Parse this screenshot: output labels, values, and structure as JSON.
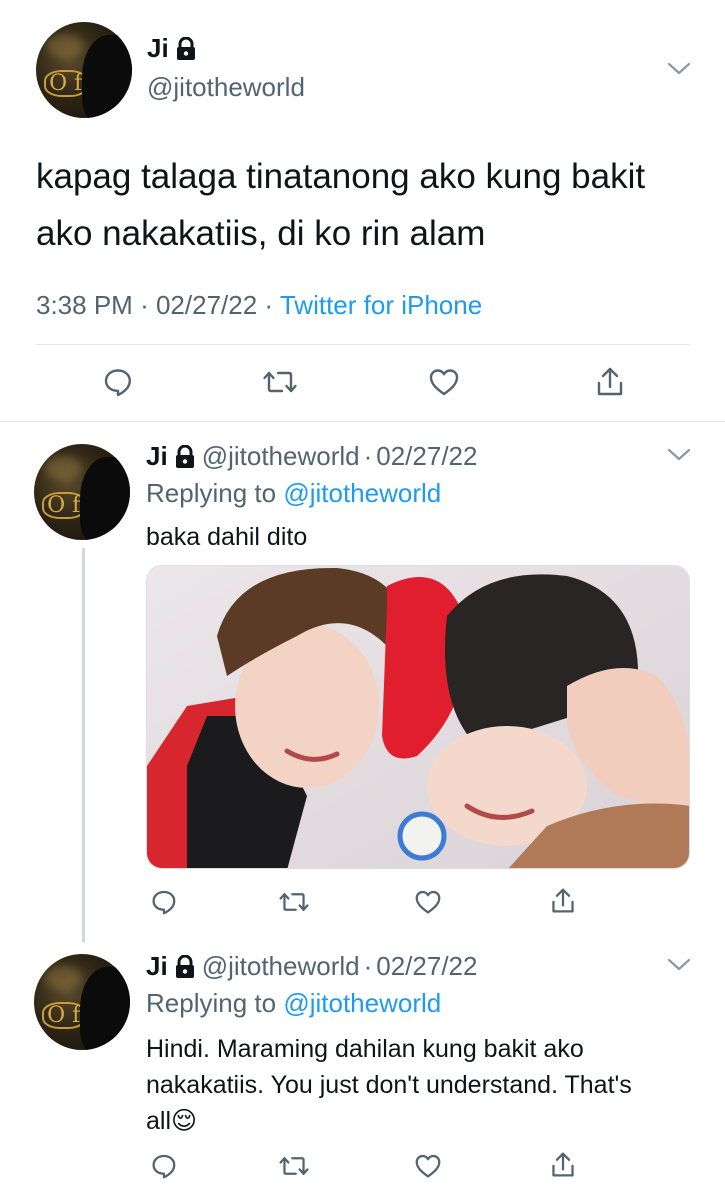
{
  "main_tweet": {
    "name": "Ji",
    "handle": "@jitotheworld",
    "text": "kapag talaga tinatanong ako kung bakit ako nakakatiis, di ko rin alam",
    "time": "3:38 PM",
    "date": "02/27/22",
    "source": "Twitter for iPhone",
    "separator": "·"
  },
  "replies": [
    {
      "name": "Ji",
      "handle": "@jitotheworld",
      "date": "02/27/22",
      "replying_prefix": "Replying to",
      "replying_to": "@jitotheworld",
      "text": "baka dahil dito",
      "has_media": true
    },
    {
      "name": "Ji",
      "handle": "@jitotheworld",
      "date": "02/27/22",
      "replying_prefix": "Replying to",
      "replying_to": "@jitotheworld",
      "text": "Hindi. Maraming dahilan kung bakit ako nakakatiis. You just don't understand. That's all",
      "emoji": "😌"
    }
  ],
  "avatar_sign": "O f",
  "icons": {
    "reply": "reply-icon",
    "retweet": "retweet-icon",
    "like": "heart-icon",
    "share": "share-icon",
    "more": "chevron-down-icon",
    "protected": "lock-icon"
  },
  "colors": {
    "text": "#0f1419",
    "secondary": "#536471",
    "link": "#1d9bf0",
    "divider": "#e3e7ea",
    "thread_line": "#cfd9de"
  }
}
